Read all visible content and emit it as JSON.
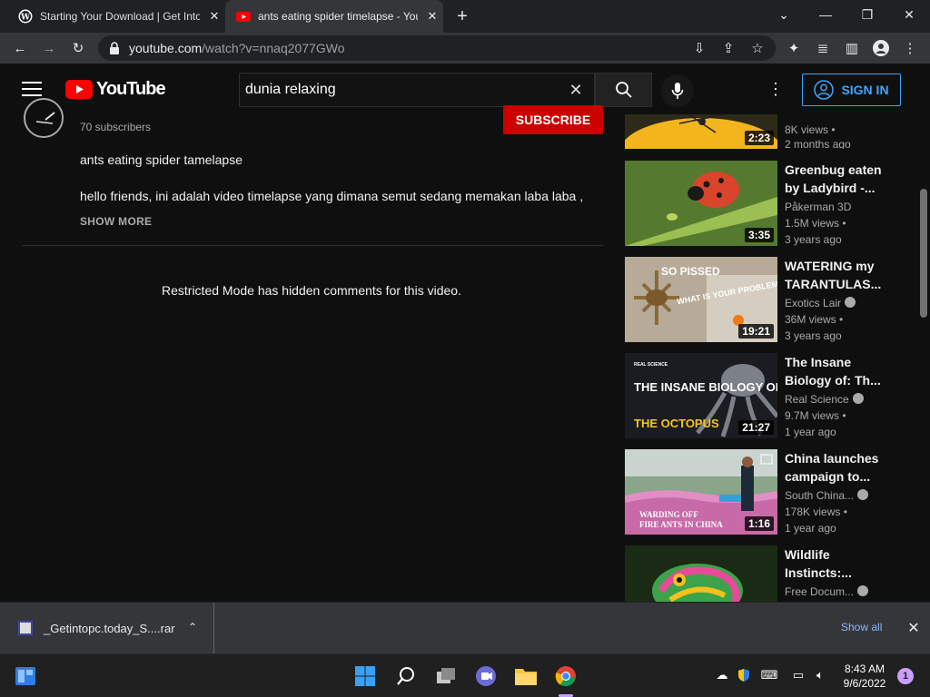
{
  "browser": {
    "tabs": [
      {
        "title": "Starting Your Download | Get Into",
        "favicon": "wordpress-icon"
      },
      {
        "title": "ants eating spider timelapse - You",
        "favicon": "youtube-icon"
      }
    ],
    "url_host": "youtube.com",
    "url_path": "/watch?v=nnaq2077GWo"
  },
  "youtube": {
    "logo_text": "YouTube",
    "search_value": "dunia relaxing",
    "sign_in": "SIGN IN"
  },
  "video": {
    "subscribers": "70 subscribers",
    "subscribe_label": "SUBSCRIBE",
    "desc_title": "ants eating spider tamelapse",
    "desc_body": "hello friends, ini adalah video timelapse yang dimana semut sedang memakan laba laba ,",
    "show_more": "SHOW MORE",
    "restricted": "Restricted Mode has hidden comments for this video."
  },
  "recommendations": [
    {
      "title": "",
      "channel": "",
      "views": "8K views",
      "age": "2 months ago",
      "duration": "2:23"
    },
    {
      "title": "Greenbug eaten by Ladybird -...",
      "channel": "Påkerman 3D",
      "views": "1.5M views",
      "age": "3 years ago",
      "duration": "3:35"
    },
    {
      "title": "WATERING my TARANTULAS...",
      "channel": "Exotics Lair",
      "views": "36M views",
      "age": "3 years ago",
      "duration": "19:21",
      "thumb_text": [
        "SO PISSED",
        "WHAT IS YOUR PROBLEM ????"
      ]
    },
    {
      "title": "The Insane Biology of: Th...",
      "channel": "Real Science",
      "views": "9.7M views",
      "age": "1 year ago",
      "duration": "21:27",
      "thumb_text": [
        "REAL SCIENCE",
        "THE INSANE BIOLOGY OF:",
        "THE OCTOPUS"
      ]
    },
    {
      "title": "China launches campaign to...",
      "channel": "South China...",
      "views": "178K views",
      "age": "1 year ago",
      "duration": "1:16",
      "thumb_text": [
        "WARDING OFF",
        "FIRE ANTS IN CHINA"
      ]
    },
    {
      "title": "Wildlife Instincts:...",
      "channel": "Free Docum...",
      "views": "",
      "age": "",
      "duration": ""
    }
  ],
  "download": {
    "filename": "_Getintopc.today_S....rar",
    "show_all": "Show all"
  },
  "taskbar": {
    "time": "8:43 AM",
    "date": "9/6/2022",
    "notifications": "1"
  },
  "colors": {
    "yt_red": "#ff0000",
    "subscribe_red": "#cc0000",
    "link_blue": "#3ea6ff"
  }
}
